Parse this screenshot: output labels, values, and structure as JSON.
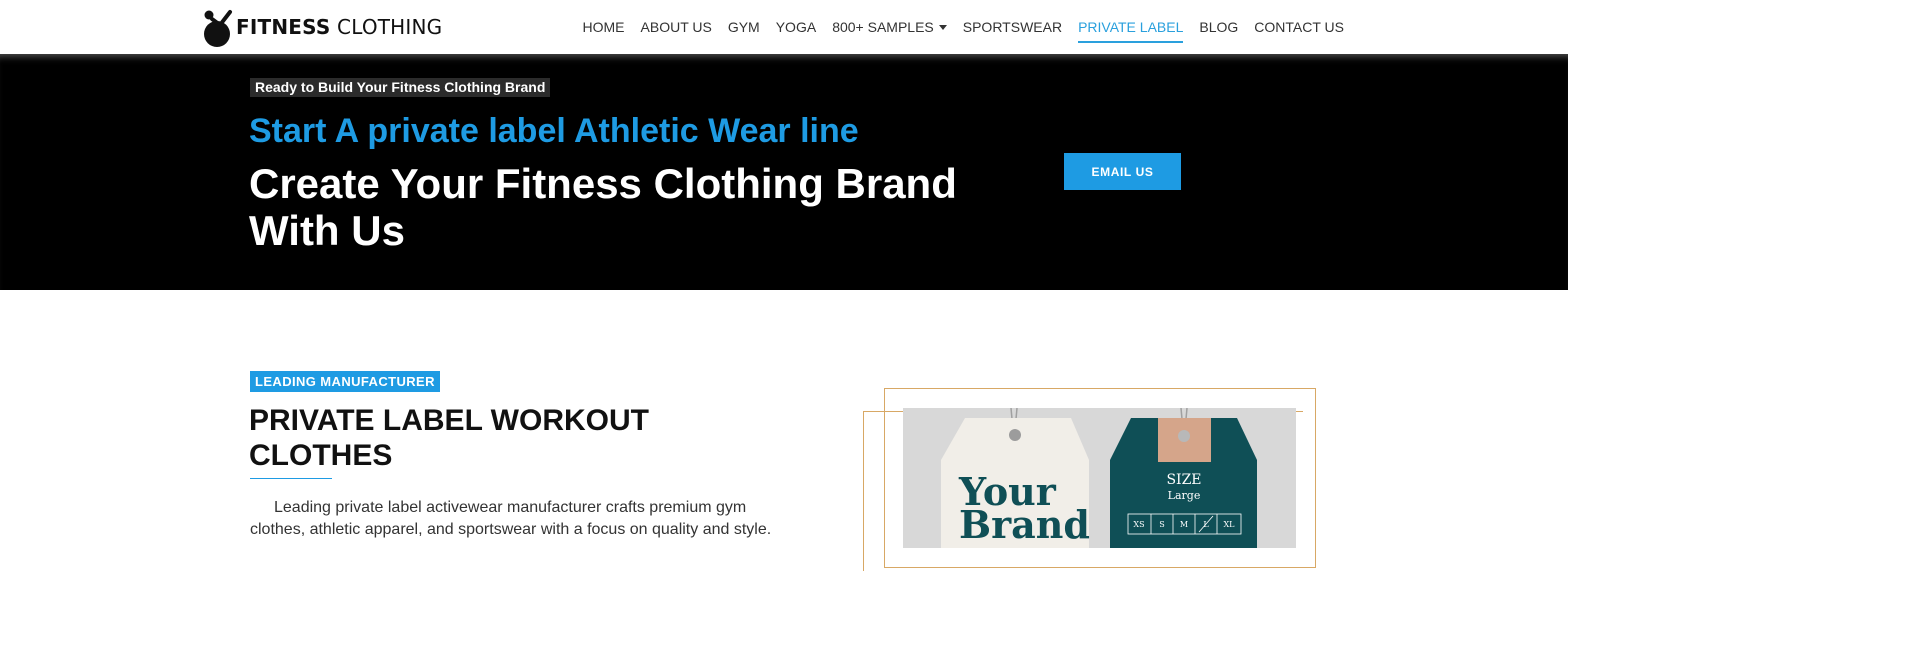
{
  "header": {
    "logo": {
      "bold": "FITNESS",
      "light": " CLOTHING"
    },
    "nav": [
      {
        "label": "HOME",
        "active": false
      },
      {
        "label": "ABOUT US",
        "active": false
      },
      {
        "label": "GYM",
        "active": false
      },
      {
        "label": "YOGA",
        "active": false
      },
      {
        "label": "800+ SAMPLES",
        "active": false,
        "dropdown": true
      },
      {
        "label": "SPORTSWEAR",
        "active": false
      },
      {
        "label": "PRIVATE LABEL",
        "active": true
      },
      {
        "label": "BLOG",
        "active": false
      },
      {
        "label": "CONTACT US",
        "active": false
      }
    ]
  },
  "hero": {
    "tag": "Ready to Build Your Fitness Clothing Brand",
    "subtitle": "Start A private label Athletic Wear line",
    "title": "Create Your Fitness Clothing Brand With Us",
    "cta": "EMAIL US"
  },
  "section": {
    "badge": "LEADING MANUFACTURER",
    "title": "PRIVATE LABEL WORKOUT CLOTHES",
    "body": "Leading private label activewear manufacturer crafts premium gym clothes, athletic apparel, and sportswear with a focus on quality and style."
  },
  "image": {
    "tag1_line1": "Your",
    "tag1_line2": "Brand",
    "tag2_title": "SIZE",
    "tag2_sub": "Large",
    "sizes": [
      "XS",
      "S",
      "M",
      "L",
      "XL"
    ]
  },
  "colors": {
    "accent": "#1e9be3",
    "hero_bg": "#000000",
    "frame": "#d8a865",
    "tag_teal": "#0f4f56"
  }
}
